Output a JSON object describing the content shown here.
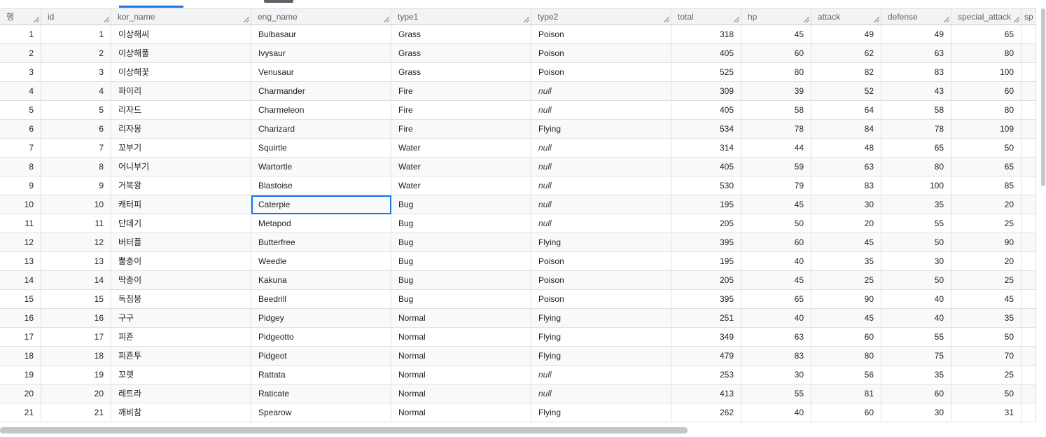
{
  "columns": [
    "행",
    "id",
    "kor_name",
    "eng_name",
    "type1",
    "type2",
    "total",
    "hp",
    "attack",
    "defense",
    "special_attack",
    "sp"
  ],
  "rows": [
    [
      "1",
      "1",
      "이상해씨",
      "Bulbasaur",
      "Grass",
      "Poison",
      "318",
      "45",
      "49",
      "49",
      "65"
    ],
    [
      "2",
      "2",
      "이상해풀",
      "Ivysaur",
      "Grass",
      "Poison",
      "405",
      "60",
      "62",
      "63",
      "80"
    ],
    [
      "3",
      "3",
      "이상해꽃",
      "Venusaur",
      "Grass",
      "Poison",
      "525",
      "80",
      "82",
      "83",
      "100"
    ],
    [
      "4",
      "4",
      "파이리",
      "Charmander",
      "Fire",
      "null",
      "309",
      "39",
      "52",
      "43",
      "60"
    ],
    [
      "5",
      "5",
      "리자드",
      "Charmeleon",
      "Fire",
      "null",
      "405",
      "58",
      "64",
      "58",
      "80"
    ],
    [
      "6",
      "6",
      "리자몽",
      "Charizard",
      "Fire",
      "Flying",
      "534",
      "78",
      "84",
      "78",
      "109"
    ],
    [
      "7",
      "7",
      "꼬부기",
      "Squirtle",
      "Water",
      "null",
      "314",
      "44",
      "48",
      "65",
      "50"
    ],
    [
      "8",
      "8",
      "어니부기",
      "Wartortle",
      "Water",
      "null",
      "405",
      "59",
      "63",
      "80",
      "65"
    ],
    [
      "9",
      "9",
      "거북왕",
      "Blastoise",
      "Water",
      "null",
      "530",
      "79",
      "83",
      "100",
      "85"
    ],
    [
      "10",
      "10",
      "캐터피",
      "Caterpie",
      "Bug",
      "null",
      "195",
      "45",
      "30",
      "35",
      "20"
    ],
    [
      "11",
      "11",
      "단데기",
      "Metapod",
      "Bug",
      "null",
      "205",
      "50",
      "20",
      "55",
      "25"
    ],
    [
      "12",
      "12",
      "버터플",
      "Butterfree",
      "Bug",
      "Flying",
      "395",
      "60",
      "45",
      "50",
      "90"
    ],
    [
      "13",
      "13",
      "뿔충이",
      "Weedle",
      "Bug",
      "Poison",
      "195",
      "40",
      "35",
      "30",
      "20"
    ],
    [
      "14",
      "14",
      "딱충이",
      "Kakuna",
      "Bug",
      "Poison",
      "205",
      "45",
      "25",
      "50",
      "25"
    ],
    [
      "15",
      "15",
      "독침붕",
      "Beedrill",
      "Bug",
      "Poison",
      "395",
      "65",
      "90",
      "40",
      "45"
    ],
    [
      "16",
      "16",
      "구구",
      "Pidgey",
      "Normal",
      "Flying",
      "251",
      "40",
      "45",
      "40",
      "35"
    ],
    [
      "17",
      "17",
      "피죤",
      "Pidgeotto",
      "Normal",
      "Flying",
      "349",
      "63",
      "60",
      "55",
      "50"
    ],
    [
      "18",
      "18",
      "피죤투",
      "Pidgeot",
      "Normal",
      "Flying",
      "479",
      "83",
      "80",
      "75",
      "70"
    ],
    [
      "19",
      "19",
      "꼬렛",
      "Rattata",
      "Normal",
      "null",
      "253",
      "30",
      "56",
      "35",
      "25"
    ],
    [
      "20",
      "20",
      "레트라",
      "Raticate",
      "Normal",
      "null",
      "413",
      "55",
      "81",
      "60",
      "50"
    ],
    [
      "21",
      "21",
      "깨비참",
      "Spearow",
      "Normal",
      "Flying",
      "262",
      "40",
      "60",
      "30",
      "31"
    ]
  ],
  "selected_cell": {
    "row": 10,
    "column": "eng_name"
  }
}
